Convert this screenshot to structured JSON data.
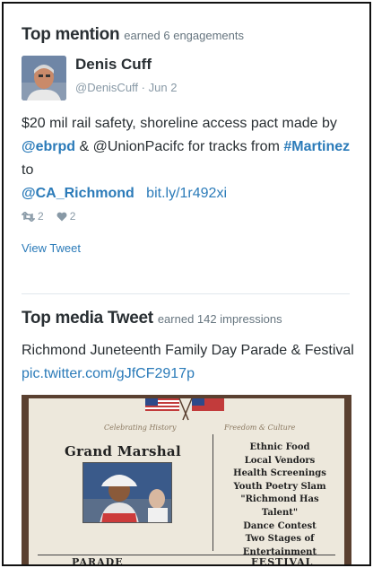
{
  "top_mention": {
    "heading": "Top mention",
    "stat": "earned 6 engagements",
    "author": {
      "name": "Denis Cuff",
      "handle": "@DenisCuff",
      "separator": "·",
      "date": "Jun 2"
    },
    "text": {
      "p1": "$20 mil rail safety, shoreline access pact made by ",
      "m1": "@ebrpd",
      "p2": " & @UnionPacifc for tracks from ",
      "m2": "#Martinez",
      "p3": " to ",
      "m3": "@CA_Richmond",
      "link": "bit.ly/1r492xi"
    },
    "retweets": "2",
    "likes": "2",
    "view_label": "View Tweet"
  },
  "top_media": {
    "heading": "Top media Tweet",
    "stat": "earned 142 impressions",
    "text": "Richmond Juneteenth Family Day Parade & Festival",
    "link": "pic.twitter.com/gJfCF2917p",
    "poster": {
      "script_left": "Celebrating History",
      "script_right": "Freedom & Culture",
      "grand_marshal": "Grand Marshal",
      "festival_items": [
        "Ethnic Food",
        "Local Vendors",
        "Health Screenings",
        "Youth Poetry Slam",
        "\"Richmond Has Talent\"",
        "Dance Contest",
        "Two Stages of",
        "Entertainment"
      ],
      "footer_left": "PARADE",
      "footer_right": "FESTIVAL"
    }
  },
  "colors": {
    "link": "#2b7bb9",
    "text": "#292f33",
    "muted": "#8899a6"
  },
  "icons": [
    "retweet-icon",
    "heart-icon",
    "us-flag-icon"
  ]
}
